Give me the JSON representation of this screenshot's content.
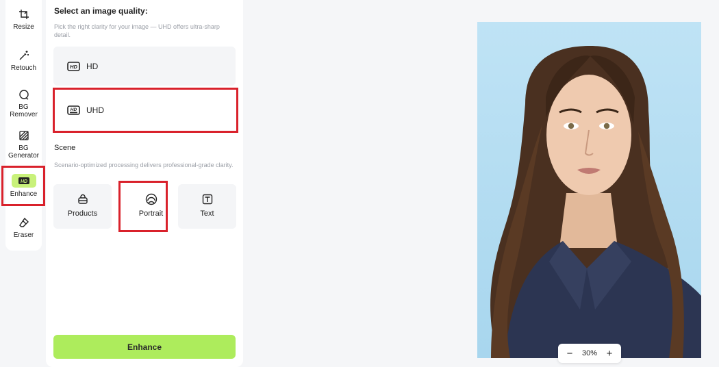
{
  "rail": {
    "items": [
      {
        "label": "Resize",
        "icon": "crop-icon"
      },
      {
        "label": "Retouch",
        "icon": "magic-wand-icon"
      },
      {
        "label": "BG\nRemover",
        "icon": "bg-remover-icon"
      },
      {
        "label": "BG\nGenerator",
        "icon": "bg-generator-icon"
      },
      {
        "label": "Enhance",
        "icon": "hd-icon",
        "active": true
      },
      {
        "label": "Eraser",
        "icon": "eraser-icon"
      }
    ],
    "active_color": "#c8f17a",
    "highlight_color": "#d9212b"
  },
  "panel": {
    "quality": {
      "title": "Select an image quality:",
      "description": "Pick the right clarity for your image — UHD offers ultra-sharp detail.",
      "options": [
        {
          "label": "HD",
          "icon": "hd-badge-icon"
        },
        {
          "label": "UHD",
          "icon": "uhd-badge-icon",
          "selected": true
        }
      ]
    },
    "scene": {
      "title": "Scene",
      "description": "Scenario-optimized processing delivers professional-grade clarity.",
      "options": [
        {
          "label": "Products",
          "icon": "bag-icon"
        },
        {
          "label": "Portrait",
          "icon": "face-icon",
          "selected": true
        },
        {
          "label": "Text",
          "icon": "text-icon"
        }
      ]
    },
    "enhance_button": "Enhance",
    "button_color": "#adec5c"
  },
  "canvas": {
    "zoom": {
      "minus": "−",
      "value": "30%",
      "plus": "+"
    }
  }
}
